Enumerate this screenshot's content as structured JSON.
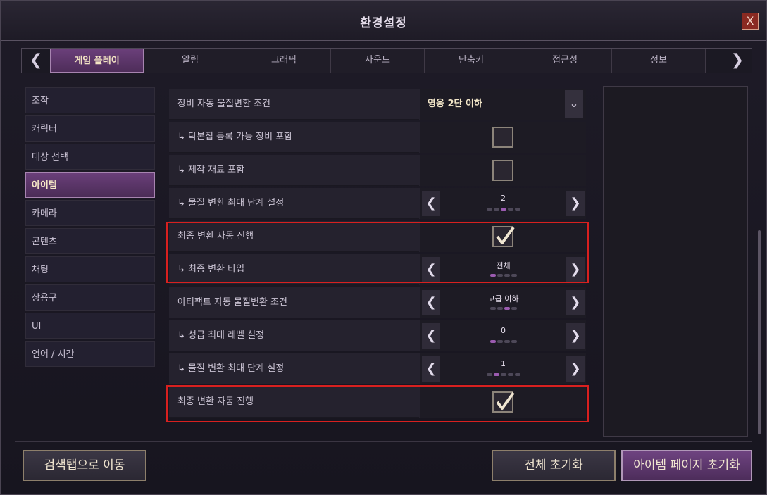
{
  "window": {
    "title": "환경설정",
    "close_label": "X"
  },
  "tabs": [
    "게임 플레이",
    "알림",
    "그래픽",
    "사운드",
    "단축키",
    "접근성",
    "정보"
  ],
  "tab_arrows": {
    "left": "❮",
    "right": "❯"
  },
  "sidebar": [
    {
      "label": "조작"
    },
    {
      "label": "캐릭터"
    },
    {
      "label": "대상 선택"
    },
    {
      "label": "아이템"
    },
    {
      "label": "카메라"
    },
    {
      "label": "콘텐츠"
    },
    {
      "label": "채팅"
    },
    {
      "label": "상용구"
    },
    {
      "label": "UI"
    },
    {
      "label": "언어 / 시간"
    }
  ],
  "settings": [
    {
      "label": "장비 자동 물질변환 조건",
      "value": "영웅 2단 이하"
    },
    {
      "label": "↳ 탁본집 등록 가능 장비 포함"
    },
    {
      "label": "↳ 제작 재료 포함"
    },
    {
      "label": "↳ 물질 변환 최대 단계 설정",
      "value": "2",
      "dots": [
        0,
        0,
        1,
        0,
        0
      ]
    },
    {
      "label": "최종 변환 자동 진행"
    },
    {
      "label": "↳  최종 변환 타입",
      "value": "전체",
      "dots": [
        1,
        0,
        0,
        0
      ]
    },
    {
      "label": "아티팩트 자동 물질변환 조건",
      "value": "고급 이하",
      "dots": [
        0,
        0,
        1,
        0
      ]
    },
    {
      "label": "↳ 성급 최대 레벨 설정",
      "value": "0",
      "dots": [
        1,
        0,
        0,
        0
      ]
    },
    {
      "label": "↳ 물질 변환 최대 단계 설정",
      "value": "1",
      "dots": [
        0,
        1,
        0,
        0,
        0
      ]
    },
    {
      "label": "최종 변환 자동 진행"
    }
  ],
  "controls": {
    "left_arrow": "❮",
    "right_arrow": "❯",
    "dropdown_arrow": "⌄"
  },
  "footer": {
    "search_button": "검색탭으로 이동",
    "reset_all_button": "전체 초기화",
    "reset_page_button": "아이템 페이지 초기화"
  },
  "colors": {
    "accent_purple": "#6a3f7a",
    "highlight_red": "#d8201f",
    "text_gold": "#f2e6c8"
  }
}
